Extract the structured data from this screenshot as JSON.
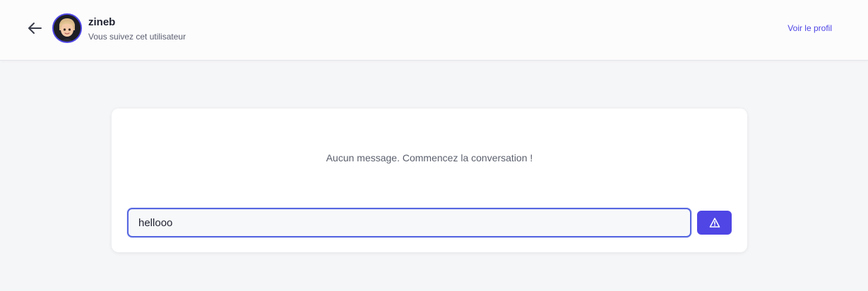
{
  "header": {
    "back_icon": "arrow-left-icon",
    "avatar_icon": "user-avatar",
    "user_name": "zineb",
    "user_status": "Vous suivez cet utilisateur",
    "profile_link": "Voir le profil"
  },
  "chat": {
    "empty_message": "Aucun message. Commencez la conversation !",
    "input_value": "hellooo",
    "send_icon": "send-triangle-icon"
  },
  "colors": {
    "accent": "#4f46e5",
    "background": "#f5f6f8",
    "card": "#ffffff"
  }
}
